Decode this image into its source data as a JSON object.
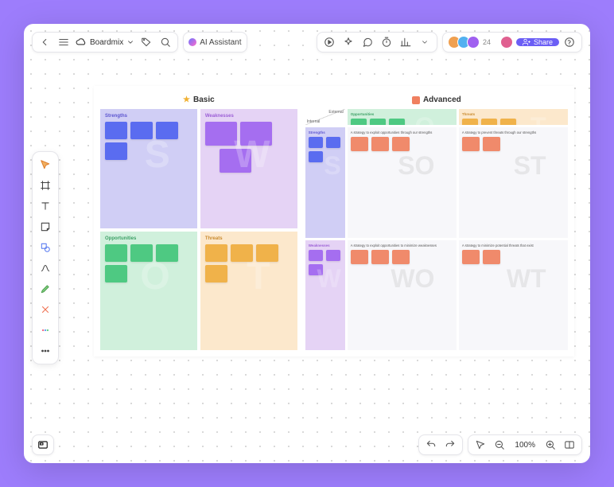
{
  "header": {
    "doc_name": "Boardmix",
    "ai_label": "AI Assistant",
    "avatar_count": "24",
    "share_label": "Share"
  },
  "zoom": "100%",
  "basic": {
    "title": "Basic",
    "quads": {
      "s": {
        "label": "Strengths",
        "letter": "S"
      },
      "w": {
        "label": "Weaknesses",
        "letter": "W"
      },
      "o": {
        "label": "Opportunities",
        "letter": "O"
      },
      "t": {
        "label": "Threats",
        "letter": "T"
      }
    }
  },
  "advanced": {
    "title": "Advanced",
    "col_ext": "External",
    "col_int": "Internal",
    "row_s": "Strengths",
    "row_w": "Weaknesses",
    "col_o": "Opportunities",
    "col_t": "Threats",
    "strategy_so": "A strategy to exploit opportunities through our strengths",
    "strategy_st": "A strategy to prevent threats through our strengths",
    "strategy_wo": "A strategy to exploit opportunities to minimize weaknesses",
    "strategy_wt": "A strategy to minimize potential threats that exist"
  }
}
